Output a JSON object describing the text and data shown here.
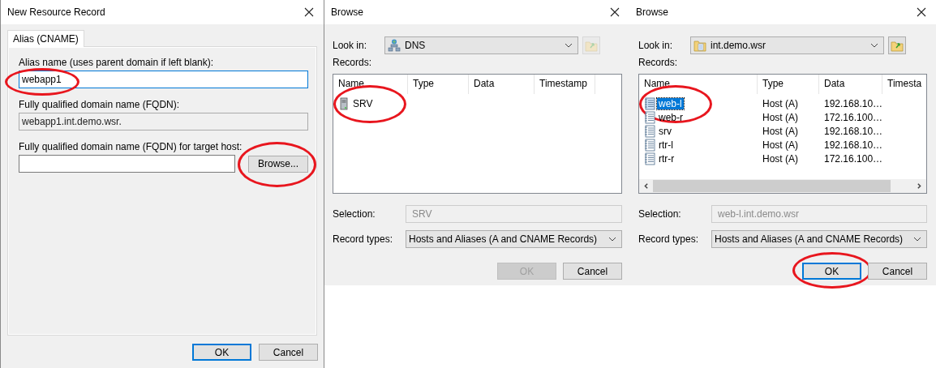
{
  "dialogs": [
    {
      "kind": "record",
      "title": "New Resource Record",
      "tabs": [
        {
          "label": "Alias (CNAME)",
          "selected": true
        }
      ],
      "fields": [
        {
          "kind": "input",
          "label": "Alias name (uses parent domain if left blank):",
          "value": "webapp1",
          "focused": true,
          "circled": true
        },
        {
          "kind": "readonly",
          "label": "Fully qualified domain name (FQDN):",
          "value": "webapp1.int.demo.wsr."
        },
        {
          "kind": "browse",
          "label": "Fully qualified domain name (FQDN) for target host:",
          "focused": false,
          "button": {
            "label": "Browse...",
            "circled": true
          }
        }
      ],
      "buttons": [
        {
          "label": "OK",
          "default": true,
          "disabled": false
        },
        {
          "label": "Cancel",
          "default": false,
          "disabled": false
        }
      ]
    },
    {
      "kind": "browse",
      "title": "Browse",
      "look_in": {
        "label": "Look in:",
        "value": "DNS"
      },
      "up_button": {
        "disabled": true
      },
      "records_label": "Records:",
      "columns": [
        "Name",
        "Type",
        "Data",
        "Timestamp"
      ],
      "rows": [
        {
          "name": "SRV",
          "selected": false,
          "circled": true
        }
      ],
      "selection": {
        "label": "Selection:",
        "value": "SRV"
      },
      "record_types": {
        "label": "Record types:",
        "value": "Hosts and Aliases (A and CNAME Records)"
      },
      "buttons": [
        {
          "label": "OK",
          "default": false,
          "disabled": true
        },
        {
          "label": "Cancel",
          "default": false,
          "disabled": false
        }
      ]
    },
    {
      "kind": "browse",
      "title": "Browse",
      "look_in": {
        "label": "Look in:",
        "value": "int.demo.wsr"
      },
      "up_button": {
        "disabled": false
      },
      "records_label": "Records:",
      "columns": [
        "Name",
        "Type",
        "Data",
        "Timesta"
      ],
      "rows": [
        {
          "name": "web-l",
          "type": "Host (A)",
          "data": "192.168.10…",
          "selected": true,
          "circled": true
        },
        {
          "name": "web-r",
          "type": "Host (A)",
          "data": "172.16.100…",
          "selected": false
        },
        {
          "name": "srv",
          "type": "Host (A)",
          "data": "192.168.10…",
          "selected": false
        },
        {
          "name": "rtr-l",
          "type": "Host (A)",
          "data": "192.168.10…",
          "selected": false
        },
        {
          "name": "rtr-r",
          "type": "Host (A)",
          "data": "172.16.100…",
          "selected": false
        }
      ],
      "horizontal_scrollbar": true,
      "selection": {
        "label": "Selection:",
        "value": "web-l.int.demo.wsr"
      },
      "record_types": {
        "label": "Record types:",
        "value": "Hosts and Aliases (A and CNAME Records)"
      },
      "buttons": [
        {
          "label": "OK",
          "default": true,
          "disabled": false,
          "circled": true
        },
        {
          "label": "Cancel",
          "default": false,
          "disabled": false
        }
      ]
    }
  ]
}
